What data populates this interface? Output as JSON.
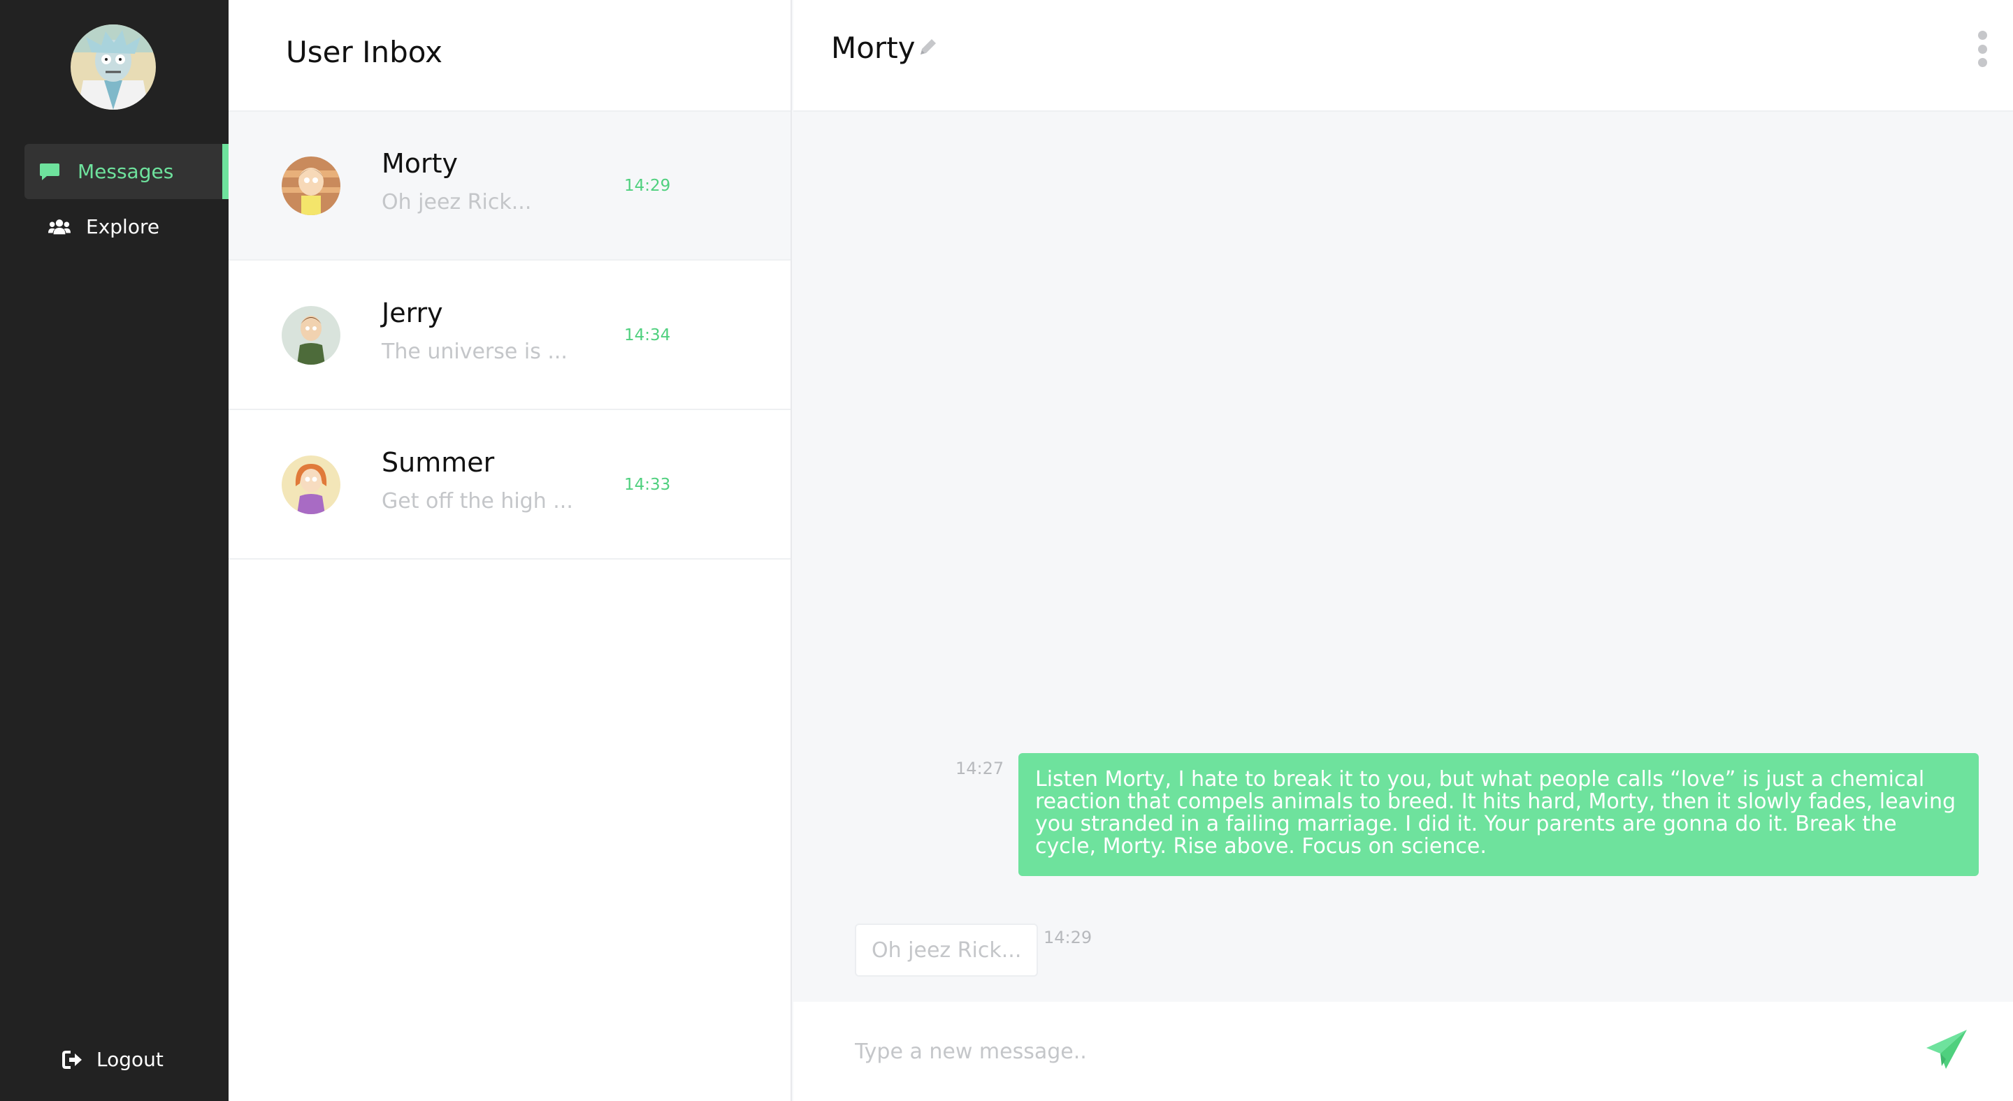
{
  "sidebar": {
    "nav": [
      {
        "label": "Messages",
        "icon": "chat-bubble-icon",
        "active": true
      },
      {
        "label": "Explore",
        "icon": "users-icon",
        "active": false
      }
    ],
    "logout_label": "Logout"
  },
  "inbox": {
    "title": "User Inbox",
    "conversations": [
      {
        "name": "Morty",
        "preview": "Oh jeez Rick...",
        "time": "14:29",
        "active": true
      },
      {
        "name": "Jerry",
        "preview": "The universe is ...",
        "time": "14:34",
        "active": false
      },
      {
        "name": "Summer",
        "preview": "Get off the high ...",
        "time": "14:33",
        "active": false
      }
    ]
  },
  "chat": {
    "title": "Morty",
    "messages": [
      {
        "direction": "outgoing",
        "time": "14:27",
        "text": "Listen Morty, I hate to break it to you, but what people calls “love” is just a chemical reaction that compels animals to breed. It hits hard, Morty, then it slowly fades, leaving you stranded in a failing marriage. I did it. Your parents are gonna do it. Break the cycle, Morty. Rise above. Focus on science."
      },
      {
        "direction": "incoming",
        "time": "14:29",
        "text": "Oh jeez Rick..."
      }
    ],
    "composer_placeholder": "Type a new message.."
  },
  "colors": {
    "accent": "#6ee29d",
    "sidebar_bg": "#222222",
    "pane_bg": "#f6f7f9"
  }
}
